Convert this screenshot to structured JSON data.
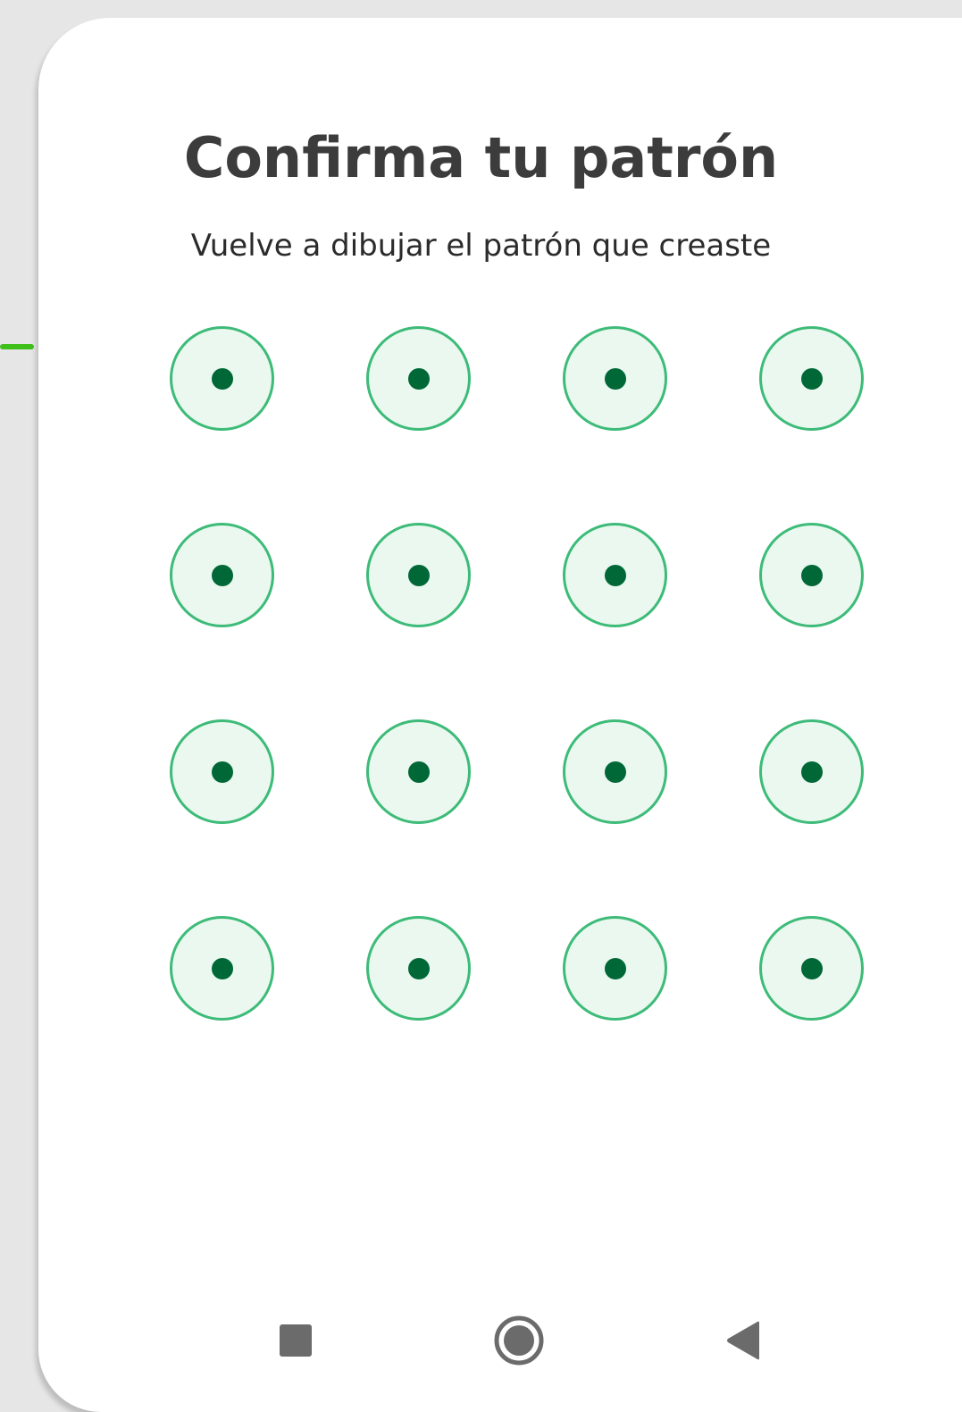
{
  "header": {
    "title": "Confirma tu patrón",
    "subtitle": "Vuelve a dibujar el patrón que creaste"
  },
  "pattern": {
    "rows": 4,
    "cols": 4,
    "colors": {
      "ring": "#3dbb78",
      "fill": "#eaf8ef",
      "dot": "#006837"
    }
  },
  "navbar": {
    "items": [
      {
        "name": "recents-button",
        "icon": "square-icon"
      },
      {
        "name": "home-button",
        "icon": "circle-icon"
      },
      {
        "name": "back-button",
        "icon": "triangle-back-icon"
      }
    ],
    "icon_color": "#6b6b6b"
  },
  "accent": "#3fbf1a"
}
